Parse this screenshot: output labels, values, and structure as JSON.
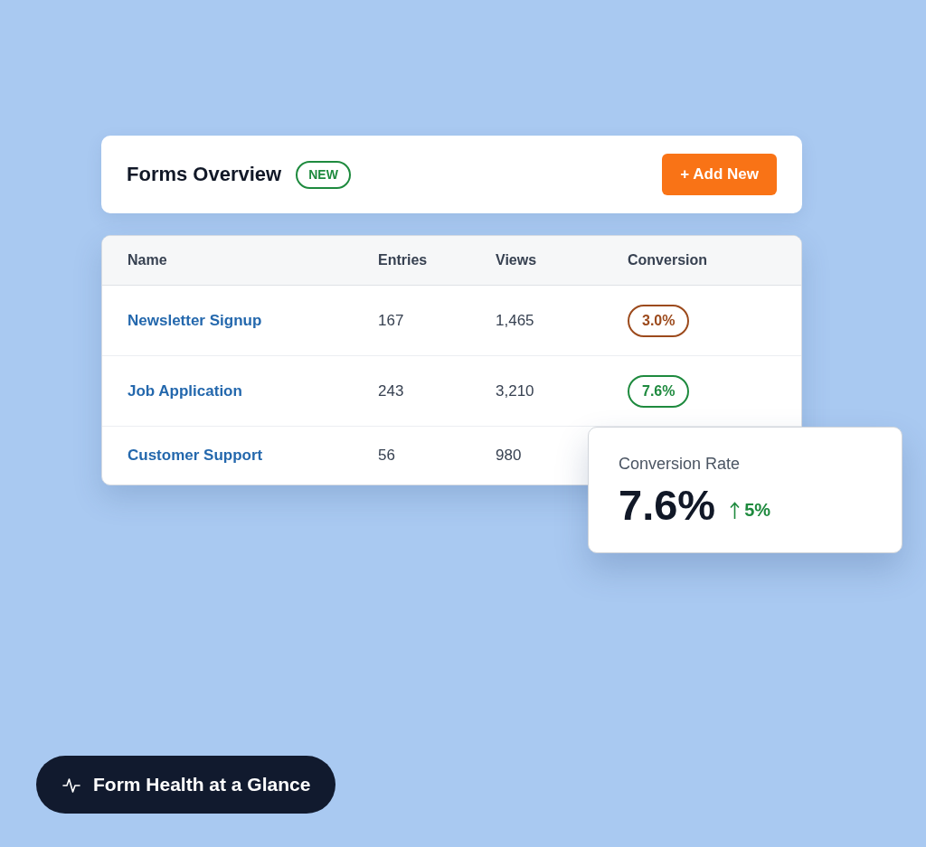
{
  "header": {
    "title": "Forms Overview",
    "badge": "NEW",
    "button": "+ Add New"
  },
  "table": {
    "columns": [
      "Name",
      "Entries",
      "Views",
      "Conversion"
    ],
    "rows": [
      {
        "name": "Newsletter Signup",
        "entries": "167",
        "views": "1,465",
        "conversion": {
          "text": "3.0%",
          "color": "#9c4a1c"
        }
      },
      {
        "name": "Job Application",
        "entries": "243",
        "views": "3,210",
        "conversion": {
          "text": "7.6%",
          "color": "#1e8a3e"
        }
      },
      {
        "name": "Customer Support",
        "entries": "56",
        "views": "980"
      }
    ]
  },
  "stat_card": {
    "label": "Conversion Rate",
    "value": "7.6%",
    "change": {
      "kind": "up",
      "text": "5%"
    }
  },
  "footer_pill": {
    "label": "Form Health at a Glance"
  }
}
